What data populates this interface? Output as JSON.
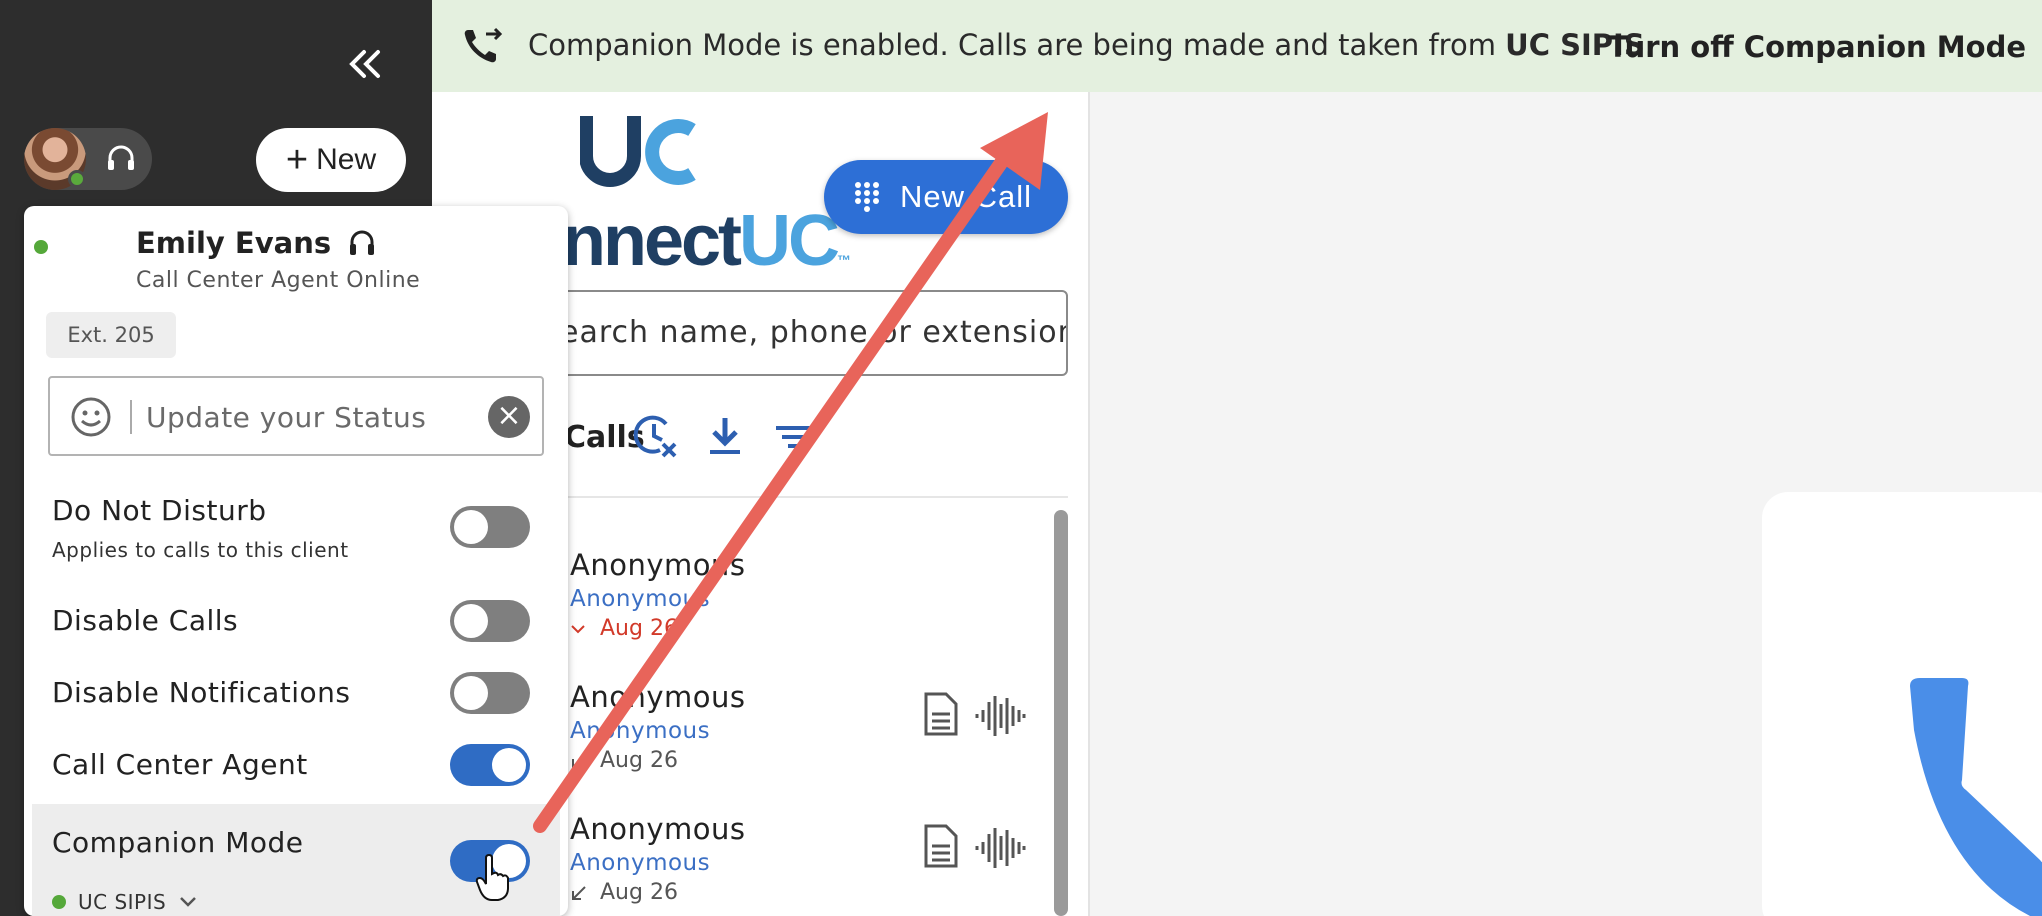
{
  "sidebar": {
    "collapse_icon": "double-chevron-left-icon",
    "new_button_label": "New",
    "new_button_plus": "+"
  },
  "banner": {
    "message_prefix": "Companion Mode is enabled. Calls are being made and taken from ",
    "message_device": "UC SIPIS",
    "message_suffix": ".",
    "action_label": "Turn off Companion Mode",
    "action_chevron": "›",
    "background_color": "#e4f0df"
  },
  "app": {
    "logo_text_dark": "nnect",
    "logo_text_light": "UC",
    "logo_tm": "™",
    "new_call_label": "New Call",
    "search_value": "earch name, phone or extension",
    "calls_title": "Calls",
    "accent_color": "#2d6fd6",
    "calls": [
      {
        "name": "Anonymous",
        "sub": "Anonymous",
        "date": "Aug 26",
        "type": "missed",
        "date_icon": "missed-arrow-icon"
      },
      {
        "name": "Anonymous",
        "sub": "Anonymous",
        "date": "Aug 26",
        "type": "incoming",
        "date_icon": "incoming-arrow-icon"
      },
      {
        "name": "Anonymous",
        "sub": "Anonymous",
        "date": "Aug 26",
        "type": "incoming",
        "date_icon": "incoming-arrow-icon"
      }
    ]
  },
  "panel": {
    "user_name": "Emily Evans",
    "role": "Call Center Agent Online",
    "extension": "Ext. 205",
    "status_placeholder": "Update your Status",
    "clear_glyph": "×",
    "options": [
      {
        "label": "Do Not Disturb",
        "sub": "Applies to calls to this client",
        "on": false
      },
      {
        "label": "Disable Calls",
        "on": false
      },
      {
        "label": "Disable Notifications",
        "on": false
      },
      {
        "label": "Call Center Agent",
        "on": true
      },
      {
        "label": "Companion Mode",
        "device": "UC SIPIS",
        "on": true
      }
    ],
    "status_color": "#55a83a",
    "toggle_on_color": "#2f6cc4"
  },
  "annotation": {
    "arrow_color": "#e8645a"
  }
}
